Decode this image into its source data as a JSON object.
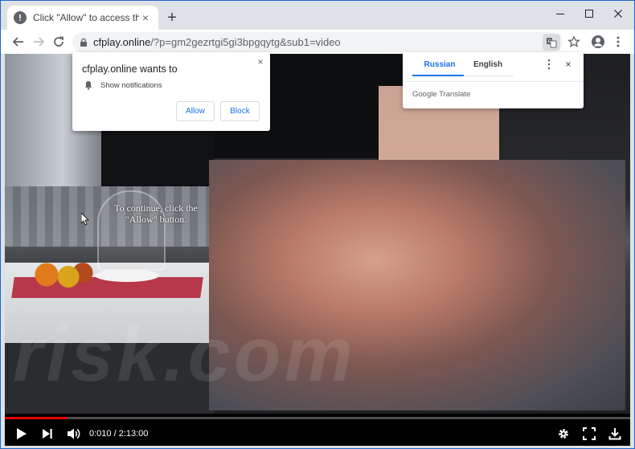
{
  "tab": {
    "title": "Click \"Allow\" to access the site!",
    "close": "×"
  },
  "new_tab": "+",
  "address_bar": {
    "host": "cfplay.online",
    "path": "/?p=gm2gezrtgi5gi3bpgqytg&sub1=video"
  },
  "notification": {
    "title": "cfplay.online wants to",
    "permission": "Show notifications",
    "allow_label": "Allow",
    "block_label": "Block",
    "close": "×"
  },
  "translate": {
    "source_lang": "Russian",
    "target_lang": "English",
    "brand": "Google Translate",
    "close": "×"
  },
  "video": {
    "overlay_line1": "To continue, click the",
    "overlay_line2": "\"Allow\" button.",
    "time_current": "0:010",
    "time_total": "2:13:00",
    "time_display": "0:010 / 2:13:00",
    "progress": 0.1
  },
  "watermark": "risk.com",
  "colors": {
    "accent": "#1a73e8",
    "progress": "#e60000",
    "window_frame": "#1e66c8"
  },
  "icons": [
    "alert-favicon-icon",
    "minimize-icon",
    "maximize-icon",
    "close-window-icon",
    "back-icon",
    "forward-icon",
    "reload-icon",
    "lock-icon",
    "translate-icon",
    "star-icon",
    "account-icon",
    "more-vert-icon",
    "bell-icon",
    "play-icon",
    "next-icon",
    "volume-icon",
    "gear-icon",
    "fullscreen-icon",
    "download-icon"
  ]
}
